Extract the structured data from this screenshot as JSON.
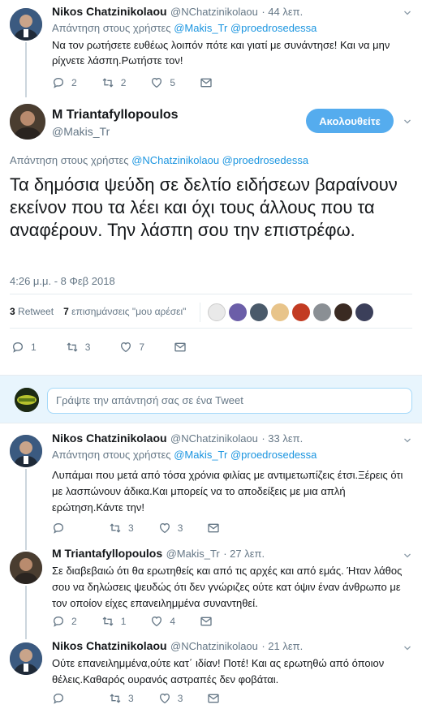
{
  "tweet1": {
    "name": "Nikos Chatzinikolaou",
    "handle": "@NChatzinikolaou",
    "time": "· 44 λεπ.",
    "reply_prefix": "Απάντηση στους χρήστες",
    "reply_users": "@Makis_Tr @proedrosedessa",
    "text": "Να τον ρωτήσετε ευθέως λοιπόν πότε και γιατί με συνάντησε! Και να μην ρίχνετε λάσπη.Ρωτήστε τον!",
    "replies": "2",
    "retweets": "2",
    "likes": "5"
  },
  "main_tweet": {
    "name": "M Triantafyllopoulos",
    "handle": "@Makis_Tr",
    "follow_label": "Ακολουθείτε",
    "reply_prefix": "Απάντηση στους χρήστες",
    "reply_users": "@NChatzinikolaou @proedrosedessa",
    "text": "Τα δημόσια ψεύδη σε δελτίο ειδήσεων βαραίνουν εκείνον που τα λέει και όχι τους άλλους που τα αναφέρουν. Την λάσπη σου την επιστρέφω.",
    "timestamp": "4:26 μ.μ. - 8 Φεβ 2018",
    "retweet_count": "3",
    "retweet_label": "Retweet",
    "likes_count": "7",
    "likes_label": "επισημάνσεις \"μου αρέσει\"",
    "replies": "1",
    "retweets": "3",
    "likes": "7"
  },
  "composer": {
    "placeholder": "Γράψτε την απάντησή σας σε ένα Tweet"
  },
  "reply1": {
    "name": "Nikos Chatzinikolaou",
    "handle": "@NChatzinikolaou",
    "time": "· 33 λεπ.",
    "reply_prefix": "Απάντηση στους χρήστες",
    "reply_users": "@Makis_Tr @proedrosedessa",
    "text": "Λυπάμαι που μετά από τόσα χρόνια φιλίας με αντιμετωπίζεις έτσι.Ξέρεις ότι με λασπώνουν άδικα.Και μπορείς να το αποδείξεις με μια απλή ερώτηση.Κάντε την!",
    "replies": "",
    "retweets": "3",
    "likes": "3"
  },
  "reply2": {
    "name": "M Triantafyllopoulos",
    "handle": "@Makis_Tr",
    "time": "· 27 λεπ.",
    "text": "Σε διαβεβαιώ ότι θα ερωτηθείς και από τις αρχές και από εμάς. Ήταν λάθος σου να δηλώσεις ψευδώς ότι δεν γνώριζες ούτε κατ όψιν  έναν άνθρωπο με τον οποίον είχες επανειλημμένα συναντηθεί.",
    "replies": "2",
    "retweets": "1",
    "likes": "4"
  },
  "reply3": {
    "name": "Nikos Chatzinikolaou",
    "handle": "@NChatzinikolaou",
    "time": "· 21 λεπ.",
    "text": "Ούτε επανειλημμένα,ούτε κατ΄ ιδίαν! Ποτέ! Και ας ερωτηθώ από όποιον θέλεις.Καθαρός ουρανός αστραπές δεν φοβάται.",
    "replies": "",
    "retweets": "3",
    "likes": "3"
  },
  "colors": {
    "accent": "#1da1f2",
    "link": "#1b95e0",
    "muted": "#657786",
    "border": "#e6ecf0"
  }
}
